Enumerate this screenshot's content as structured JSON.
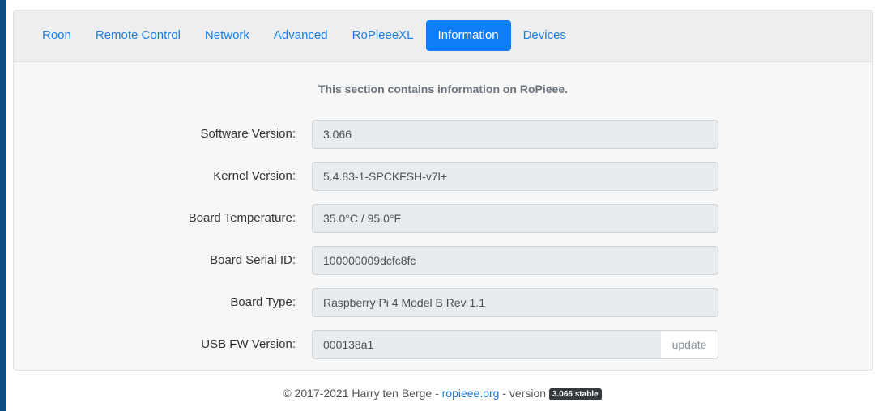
{
  "tabs": [
    {
      "label": "Roon"
    },
    {
      "label": "Remote Control"
    },
    {
      "label": "Network"
    },
    {
      "label": "Advanced"
    },
    {
      "label": "RoPieeeXL"
    },
    {
      "label": "Information",
      "active": true
    },
    {
      "label": "Devices"
    }
  ],
  "intro": "This section contains information on RoPieee.",
  "info": {
    "software_version": {
      "label": "Software Version:",
      "value": "3.066"
    },
    "kernel_version": {
      "label": "Kernel Version:",
      "value": "5.4.83-1-SPCKFSH-v7l+"
    },
    "board_temperature": {
      "label": "Board Temperature:",
      "value": "35.0°C  / 95.0°F"
    },
    "board_serial_id": {
      "label": "Board Serial ID:",
      "value": "100000009dcfc8fc"
    },
    "board_type": {
      "label": "Board Type:",
      "value": "Raspberry Pi 4 Model B Rev 1.1"
    },
    "usb_fw_version": {
      "label": "USB FW Version:",
      "value": "000138a1",
      "button": "update"
    }
  },
  "footer": {
    "copyright": "© 2017-2021 Harry ten Berge - ",
    "link": "ropieee.org",
    "version_prefix": " - version ",
    "badge": "3.066 stable"
  },
  "colors": {
    "accent": "#0d7ef6",
    "link": "#1c7fe6",
    "window_border": "#0b4f86"
  }
}
